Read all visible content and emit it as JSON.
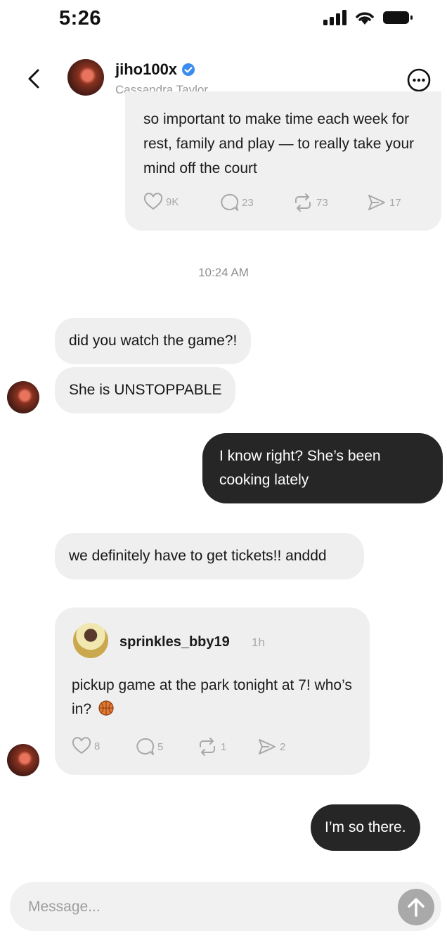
{
  "status_bar": {
    "time": "5:26"
  },
  "header": {
    "username": "jiho100x",
    "subtitle": "Cassandra Taylor"
  },
  "shared_post": {
    "text": "so important to make time each week for rest, family and play — to really take your mind off the court",
    "stats": {
      "likes": "9K",
      "comments": "23",
      "reposts": "73",
      "shares": "17"
    }
  },
  "timestamp": "10:24 AM",
  "messages": [
    {
      "from": "them",
      "text": "did you watch the game?!"
    },
    {
      "from": "them",
      "text": "She is UNSTOPPABLE"
    },
    {
      "from": "me",
      "text": "I know right? She’s been cooking lately"
    },
    {
      "from": "them",
      "text": "we definitely have to get tickets!! anddd"
    },
    {
      "from": "me",
      "text": "I’m so there."
    }
  ],
  "embedded_post": {
    "username": "sprinkles_bby19",
    "time": "1h",
    "text": "pickup game at the park tonight at 7! who’s in?",
    "stats": {
      "likes": "8",
      "comments": "5",
      "reposts": "1",
      "shares": "2"
    }
  },
  "composer": {
    "placeholder": "Message..."
  },
  "colors": {
    "verified": "#3b8cf0",
    "outgoing_bubble": "#262626",
    "incoming_bubble": "#efefef"
  }
}
